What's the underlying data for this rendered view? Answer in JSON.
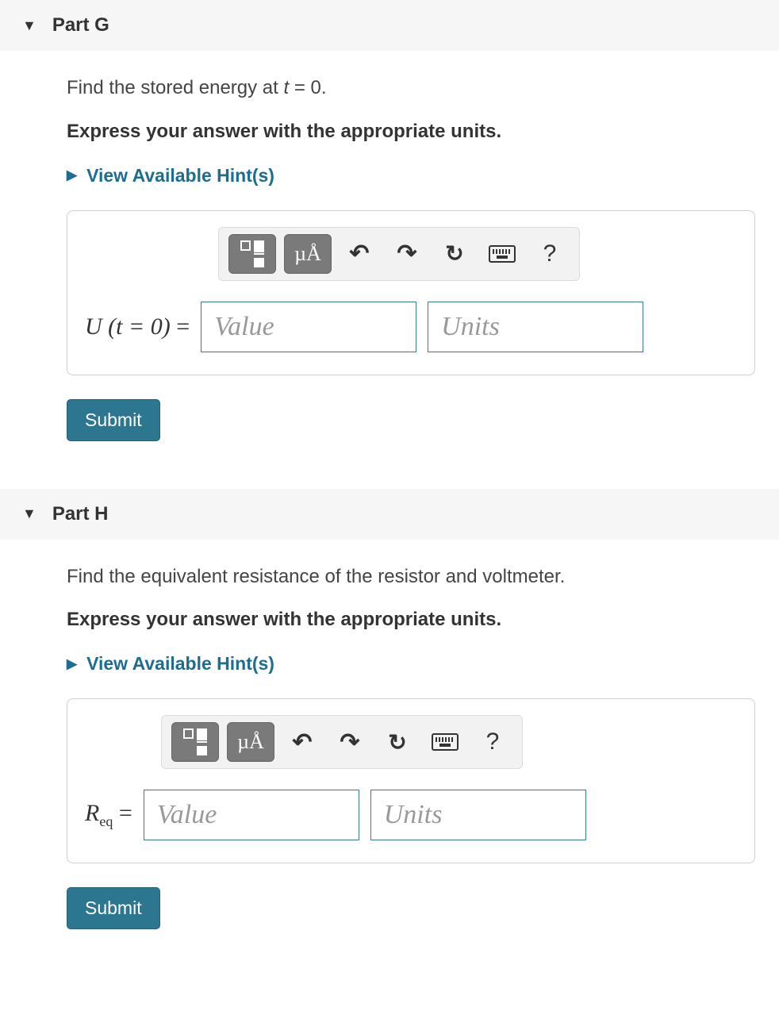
{
  "hints_label": "View Available Hint(s)",
  "submit_label": "Submit",
  "toolbar": {
    "templates_tip": "Templates",
    "symbols_label": "µÅ",
    "undo_glyph": "↶",
    "redo_glyph": "↷",
    "reset_glyph": "↻",
    "keyboard_tip": "Keyboard",
    "help_glyph": "?"
  },
  "inputs": {
    "value_placeholder": "Value",
    "units_placeholder": "Units"
  },
  "parts": [
    {
      "title": "Part G",
      "question_html": "Find the stored energy at <i>t</i> = 0.",
      "instruction": "Express your answer with the appropriate units.",
      "label_html": "<i>U</i> (<i>t</i> = 0) <span class='rom'>=</span>",
      "value_width": 272,
      "units_width": 272,
      "toolbar_indent": 168
    },
    {
      "title": "Part H",
      "question_html": "Find the equivalent resistance of the resistor and voltmeter.",
      "instruction": "Express your answer with the appropriate units.",
      "label_html": "<i>R</i><sub>eq</sub> <span class='rom'>=</span>",
      "value_width": 272,
      "units_width": 272,
      "toolbar_indent": 96
    }
  ]
}
